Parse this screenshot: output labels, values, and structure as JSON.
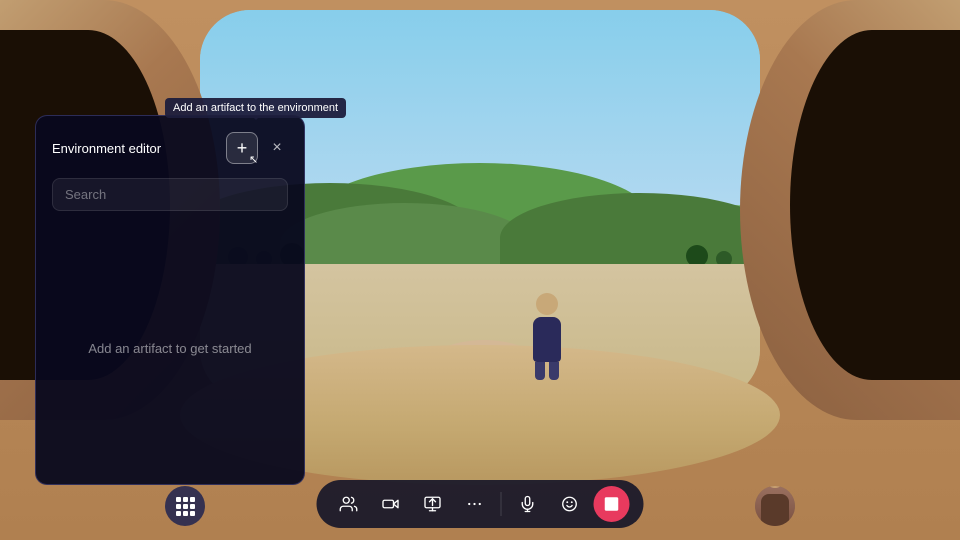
{
  "scene": {
    "background_color": "#c8a87a"
  },
  "tooltip": {
    "text": "Add an artifact to the environment"
  },
  "env_panel": {
    "title": "Environment editor",
    "search_placeholder": "Search",
    "empty_message": "Add an artifact to get started",
    "add_btn_label": "+",
    "close_btn_label": "×"
  },
  "toolbar": {
    "buttons": [
      {
        "name": "people-icon",
        "label": "👥",
        "type": "normal"
      },
      {
        "name": "video-icon",
        "label": "🎬",
        "type": "normal"
      },
      {
        "name": "screen-share-icon",
        "label": "🖥",
        "type": "normal"
      },
      {
        "name": "more-icon",
        "label": "···",
        "type": "normal"
      },
      {
        "name": "mic-icon",
        "label": "🎤",
        "type": "normal"
      },
      {
        "name": "emoji-icon",
        "label": "😊",
        "type": "normal"
      },
      {
        "name": "share-icon",
        "label": "⬛",
        "type": "red"
      }
    ]
  },
  "bottom_left": {
    "label": "⊞"
  }
}
